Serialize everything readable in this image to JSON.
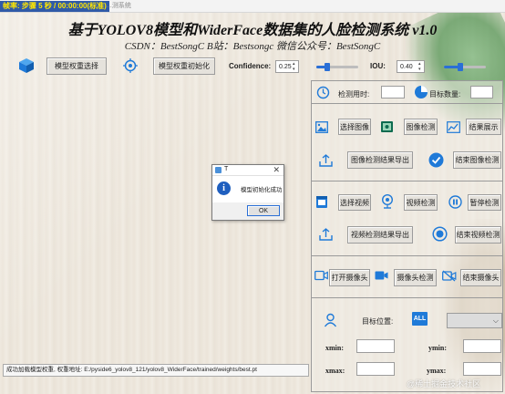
{
  "titlebar": {
    "status_overlay": "帧率: 步骤 5 秒 / 00:00:00(标准)",
    "window_title": "...测系统"
  },
  "header": {
    "title": "基于YOLOV8模型和WiderFace数据集的人脸检测系统 v1.0",
    "subtitle": "CSDN：BestSongC   B站：Bestsongc   微信公众号：BestSongC"
  },
  "toolbar": {
    "model_select_label": "模型权重选择",
    "model_init_label": "模型权重初始化",
    "confidence_label": "Confidence:",
    "confidence_value": "0.25",
    "confidence_slider": 0.25,
    "iou_label": "IOU:",
    "iou_value": "0.40",
    "iou_slider": 0.4
  },
  "right_panel": {
    "time_label": "检测用时:",
    "time_value": "",
    "count_label": "目标数量:",
    "count_value": "",
    "image": {
      "select_label": "选择图像",
      "detect_label": "图像检测",
      "show_result_label": "结果展示",
      "export_label": "图像检测结果导出",
      "end_label": "结束图像检测"
    },
    "video": {
      "select_label": "选择视频",
      "detect_label": "视频检测",
      "pause_label": "暂停检测",
      "export_label": "视频检测结果导出",
      "end_label": "结束视频检测"
    },
    "camera": {
      "open_label": "打开摄像头",
      "detect_label": "摄像头检测",
      "end_label": "结束摄像头"
    },
    "target": {
      "position_label": "目标位置:",
      "all_badge": "ALL",
      "xmin_label": "xmin:",
      "ymin_label": "ymin:",
      "xmax_label": "xmax:",
      "ymax_label": "ymax:"
    }
  },
  "status_message": "成功加载模型权重, 权重地址: E:/pyside6_yolov8_121/yolov8_WiderFace/trained/weights/best.pt",
  "dialog": {
    "title": "T",
    "message": "模型初始化成功",
    "ok_label": "OK"
  },
  "watermark": "@稀土掘金技术社区",
  "colors": {
    "accent": "#2a6fd6",
    "icon_blue": "#1f7ad8",
    "status_bg": "#2f5aa8",
    "status_text": "#ffe600"
  }
}
